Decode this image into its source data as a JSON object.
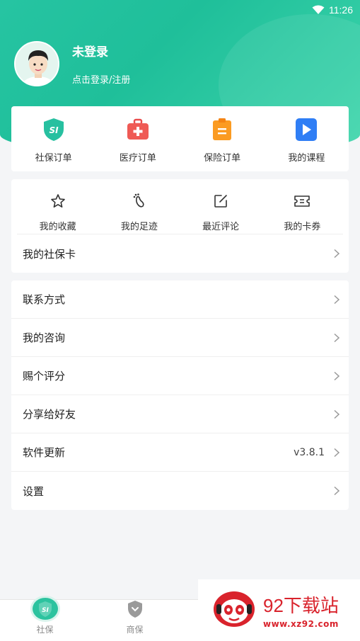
{
  "status_bar": {
    "time": "11:26"
  },
  "profile": {
    "name": "未登录",
    "subtitle": "点击登录/注册"
  },
  "orders": [
    {
      "label": "社保订单",
      "icon": "si-shield-icon"
    },
    {
      "label": "医疗订单",
      "icon": "medical-kit-icon"
    },
    {
      "label": "保险订单",
      "icon": "clipboard-icon"
    },
    {
      "label": "我的课程",
      "icon": "play-icon"
    }
  ],
  "quick": [
    {
      "label": "我的收藏",
      "icon": "star-icon"
    },
    {
      "label": "我的足迹",
      "icon": "footprint-icon"
    },
    {
      "label": "最近评论",
      "icon": "edit-icon"
    },
    {
      "label": "我的卡券",
      "icon": "ticket-icon"
    }
  ],
  "social_card": {
    "label": "我的社保卡"
  },
  "menu": [
    {
      "label": "联系方式"
    },
    {
      "label": "我的咨询"
    },
    {
      "label": "赐个评分"
    },
    {
      "label": "分享给好友"
    },
    {
      "label": "软件更新",
      "value": "v3.8.1"
    },
    {
      "label": "设置"
    }
  ],
  "tabs": [
    {
      "label": "社保"
    },
    {
      "label": "商保"
    }
  ],
  "watermark": {
    "title": "92下载站",
    "url": "www.xz92.com"
  },
  "colors": {
    "brand": "#26c4a2",
    "watermark_red": "#d9232c"
  }
}
